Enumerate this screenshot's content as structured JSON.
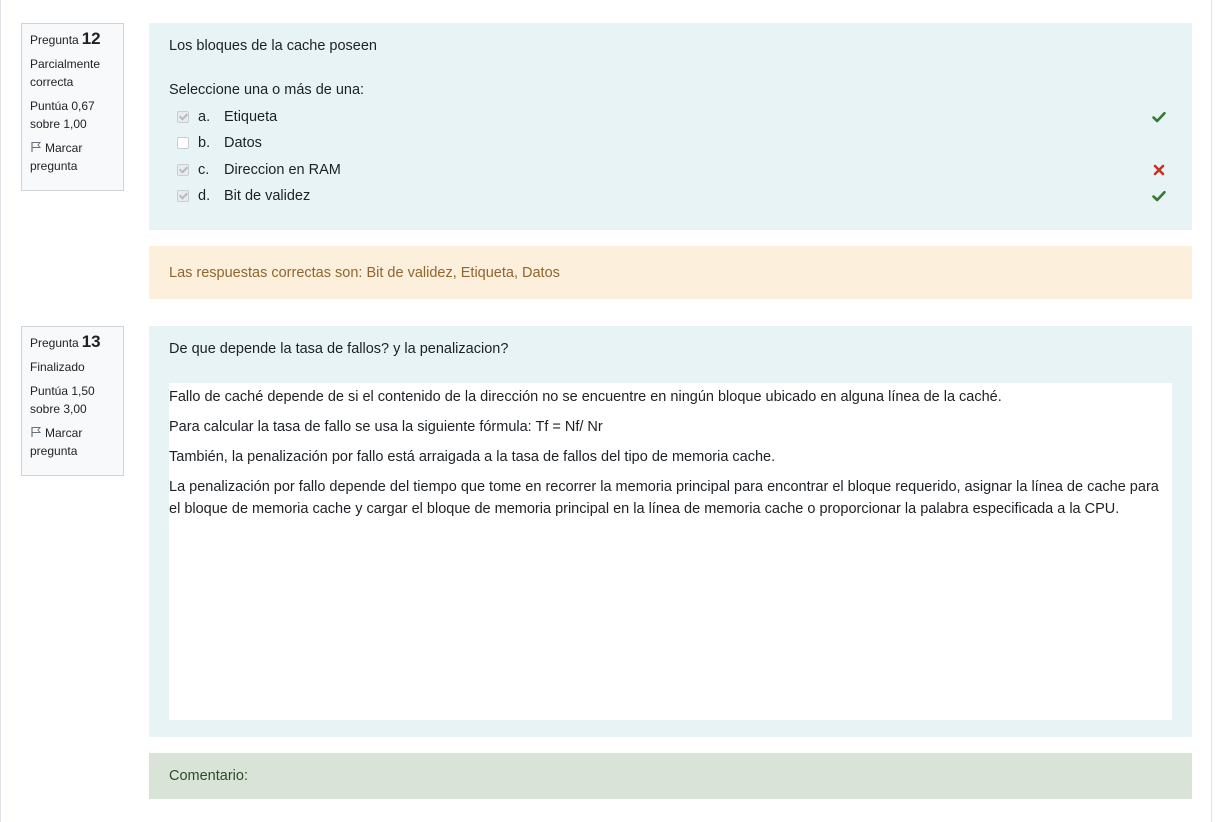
{
  "q12": {
    "label": "Pregunta",
    "number": "12",
    "state": "Parcialmente correcta",
    "grade": "Puntúa 0,67 sobre 1,00",
    "flag": "Marcar pregunta",
    "text": "Los bloques de la cache poseen",
    "prompt": "Seleccione una o más de una:",
    "options": [
      {
        "letter": "a.",
        "label": "Etiqueta",
        "checked": true,
        "result": "correct-icon"
      },
      {
        "letter": "b.",
        "label": "Datos",
        "checked": false,
        "result": ""
      },
      {
        "letter": "c.",
        "label": "Direccion en RAM",
        "checked": true,
        "result": "incorrect-icon"
      },
      {
        "letter": "d.",
        "label": "Bit de validez",
        "checked": true,
        "result": "correct-icon"
      }
    ],
    "feedback": "Las respuestas correctas son: Bit de validez, Etiqueta, Datos"
  },
  "q13": {
    "label": "Pregunta",
    "number": "13",
    "state": "Finalizado",
    "grade": "Puntúa 1,50 sobre 3,00",
    "flag": "Marcar pregunta",
    "text": "De que depende la tasa de fallos? y la penalizacion?",
    "answer": [
      "Fallo de caché depende de si el contenido de la dirección no se encuentre en ningún bloque ubicado en alguna línea de la caché.",
      "Para calcular la tasa de fallo se usa la siguiente fórmula: Tf = Nf/ Nr",
      "También, la penalización por fallo está arraigada a la tasa de fallos del tipo de memoria cache.",
      "La penalización por fallo depende del tiempo que tome en recorrer la memoria principal para encontrar el bloque requerido, asignar la línea de cache para el bloque de memoria cache y cargar el bloque de memoria principal en la línea de memoria cache o proporcionar la palabra especificada a la CPU."
    ],
    "comment": "Comentario:"
  },
  "colors": {
    "content_bg": "#e7f3f5",
    "feedback_bg": "#fcefdc",
    "feedback_text": "#8e662e",
    "comment_bg": "#d9e3d8",
    "correct": "#357a32",
    "incorrect": "#ca3120"
  }
}
